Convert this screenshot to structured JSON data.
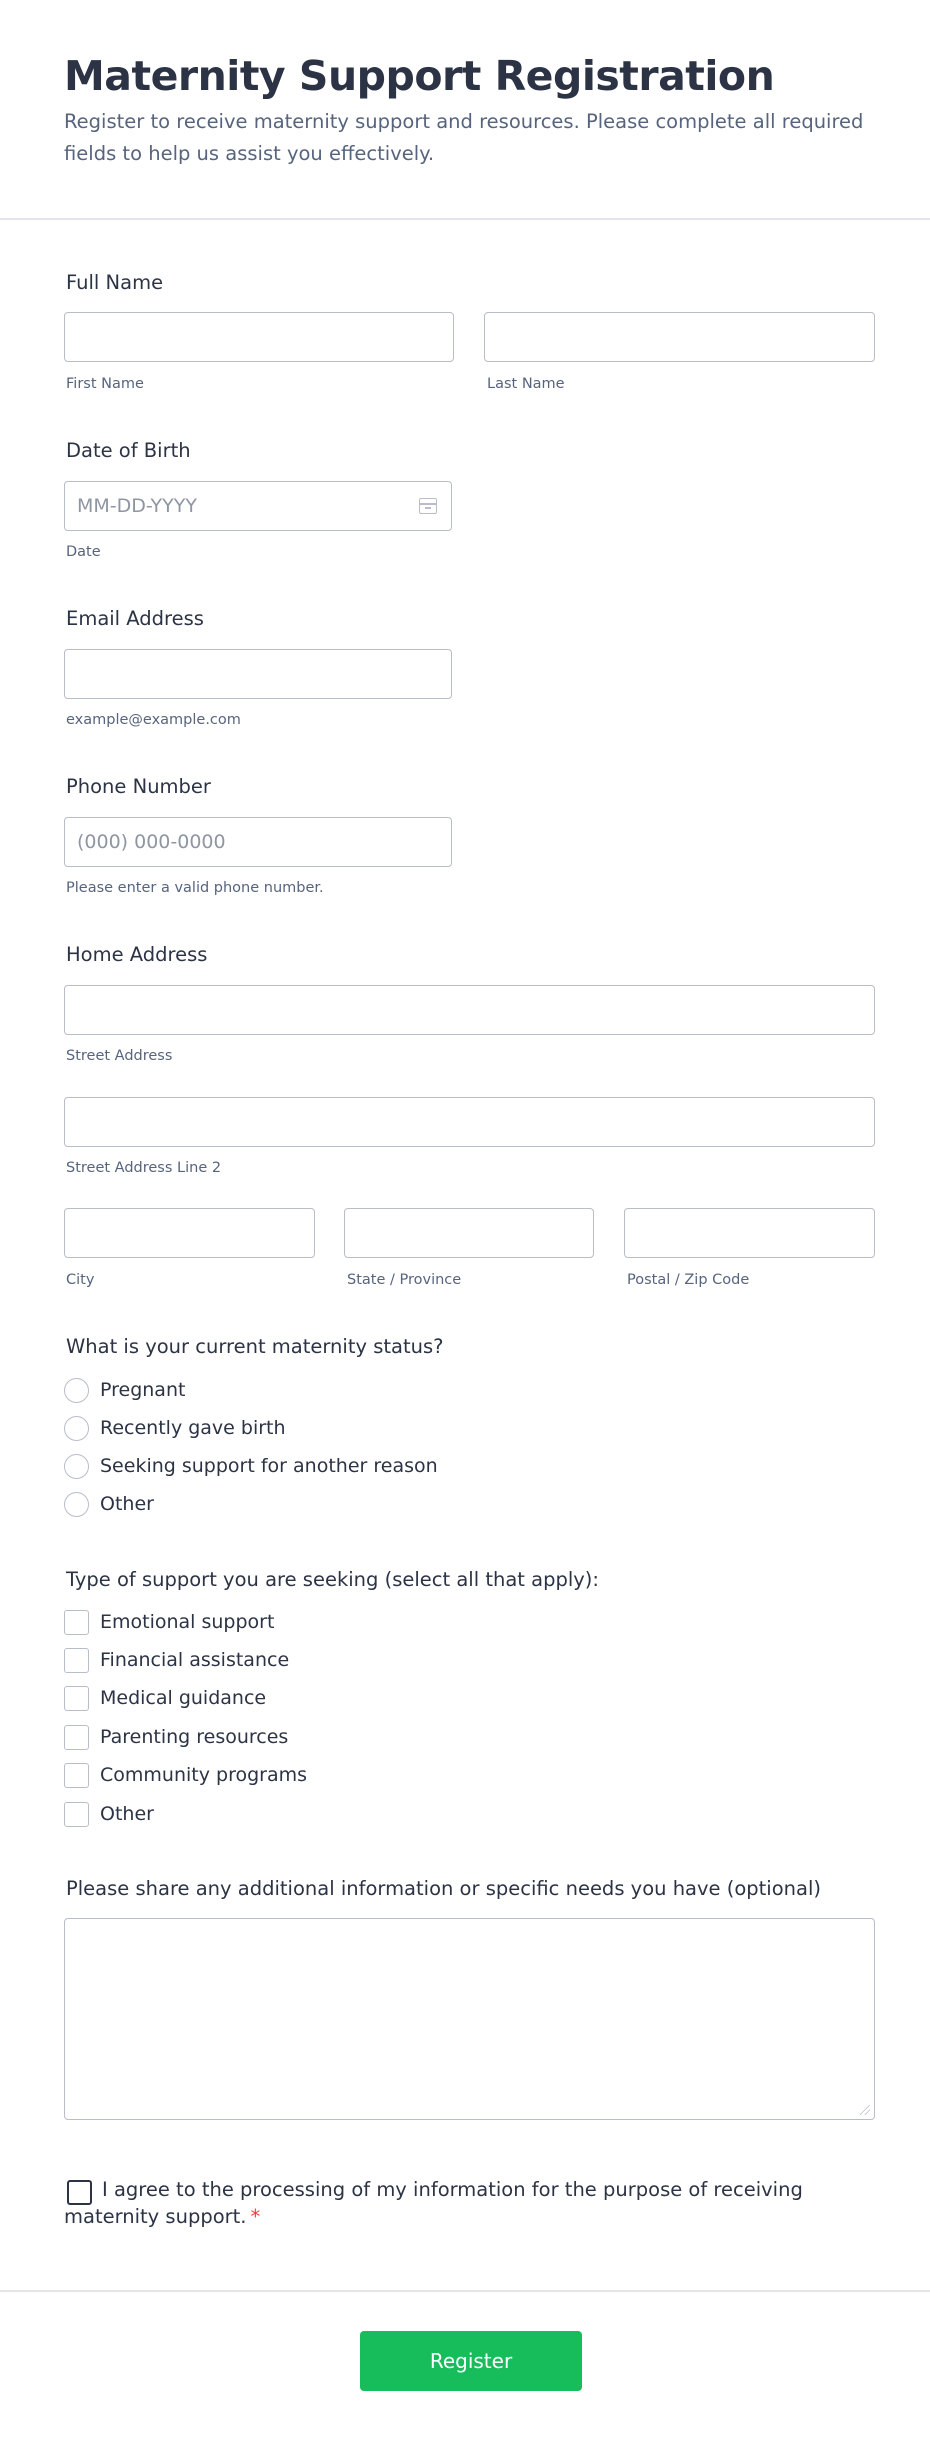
{
  "header": {
    "title": "Maternity Support Registration",
    "subtitle": "Register to receive maternity support and resources. Please complete all required fields to help us assist you effectively."
  },
  "full_name": {
    "label": "Full Name",
    "first_sub": "First Name",
    "last_sub": "Last Name",
    "first_value": "",
    "last_value": ""
  },
  "dob": {
    "label": "Date of Birth",
    "placeholder": "MM-DD-YYYY",
    "sub": "Date",
    "icon": "calendar-icon"
  },
  "email": {
    "label": "Email Address",
    "sub": "example@example.com",
    "value": ""
  },
  "phone": {
    "label": "Phone Number",
    "placeholder": "(000) 000-0000",
    "sub": "Please enter a valid phone number."
  },
  "address": {
    "label": "Home Address",
    "street_sub": "Street Address",
    "street2_sub": "Street Address Line 2",
    "city_sub": "City",
    "state_sub": "State / Province",
    "zip_sub": "Postal / Zip Code"
  },
  "status": {
    "question": "What is your current maternity status?",
    "options": [
      "Pregnant",
      "Recently gave birth",
      "Seeking support for another reason",
      "Other"
    ]
  },
  "support": {
    "question": "Type of support you are seeking (select all that apply):",
    "options": [
      "Emotional support",
      "Financial assistance",
      "Medical guidance",
      "Parenting resources",
      "Community programs",
      "Other"
    ]
  },
  "additional": {
    "label": "Please share any additional information or specific needs you have (optional)",
    "value": ""
  },
  "consent": {
    "text": "I agree to the processing of my information for the purpose of receiving maternity support.",
    "required_mark": "*"
  },
  "submit": {
    "label": "Register"
  },
  "colors": {
    "accent": "#18bd5b",
    "required": "#f23a3c",
    "text": "#2c3345",
    "muted": "#57647e",
    "border": "#b8bdc9"
  }
}
